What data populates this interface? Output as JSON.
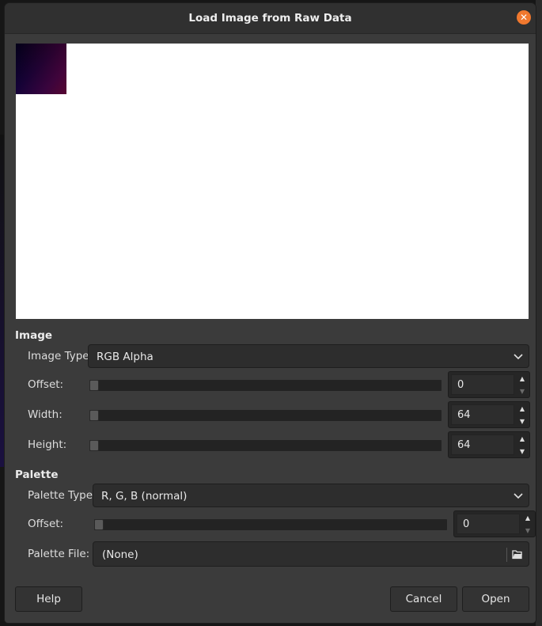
{
  "dialog": {
    "title": "Load Image from Raw Data",
    "close_icon": "close-icon"
  },
  "image_section": {
    "heading": "Image",
    "image_type_label": "Image Type:",
    "image_type_value": "RGB Alpha",
    "offset_label": "Offset:",
    "offset_value": "0",
    "width_label": "Width:",
    "width_value": "64",
    "height_label": "Height:",
    "height_value": "64"
  },
  "palette_section": {
    "heading": "Palette",
    "palette_type_label": "Palette Type:",
    "palette_type_value": "R, G, B (normal)",
    "offset_label": "Offset:",
    "offset_value": "0",
    "palette_file_label": "Palette File:",
    "palette_file_value": "(None)"
  },
  "buttons": {
    "help": "Help",
    "cancel": "Cancel",
    "open": "Open"
  },
  "colors": {
    "accent_close": "#f0782e",
    "dialog_bg": "#3b3b3b",
    "preview_bg": "#ffffff"
  }
}
